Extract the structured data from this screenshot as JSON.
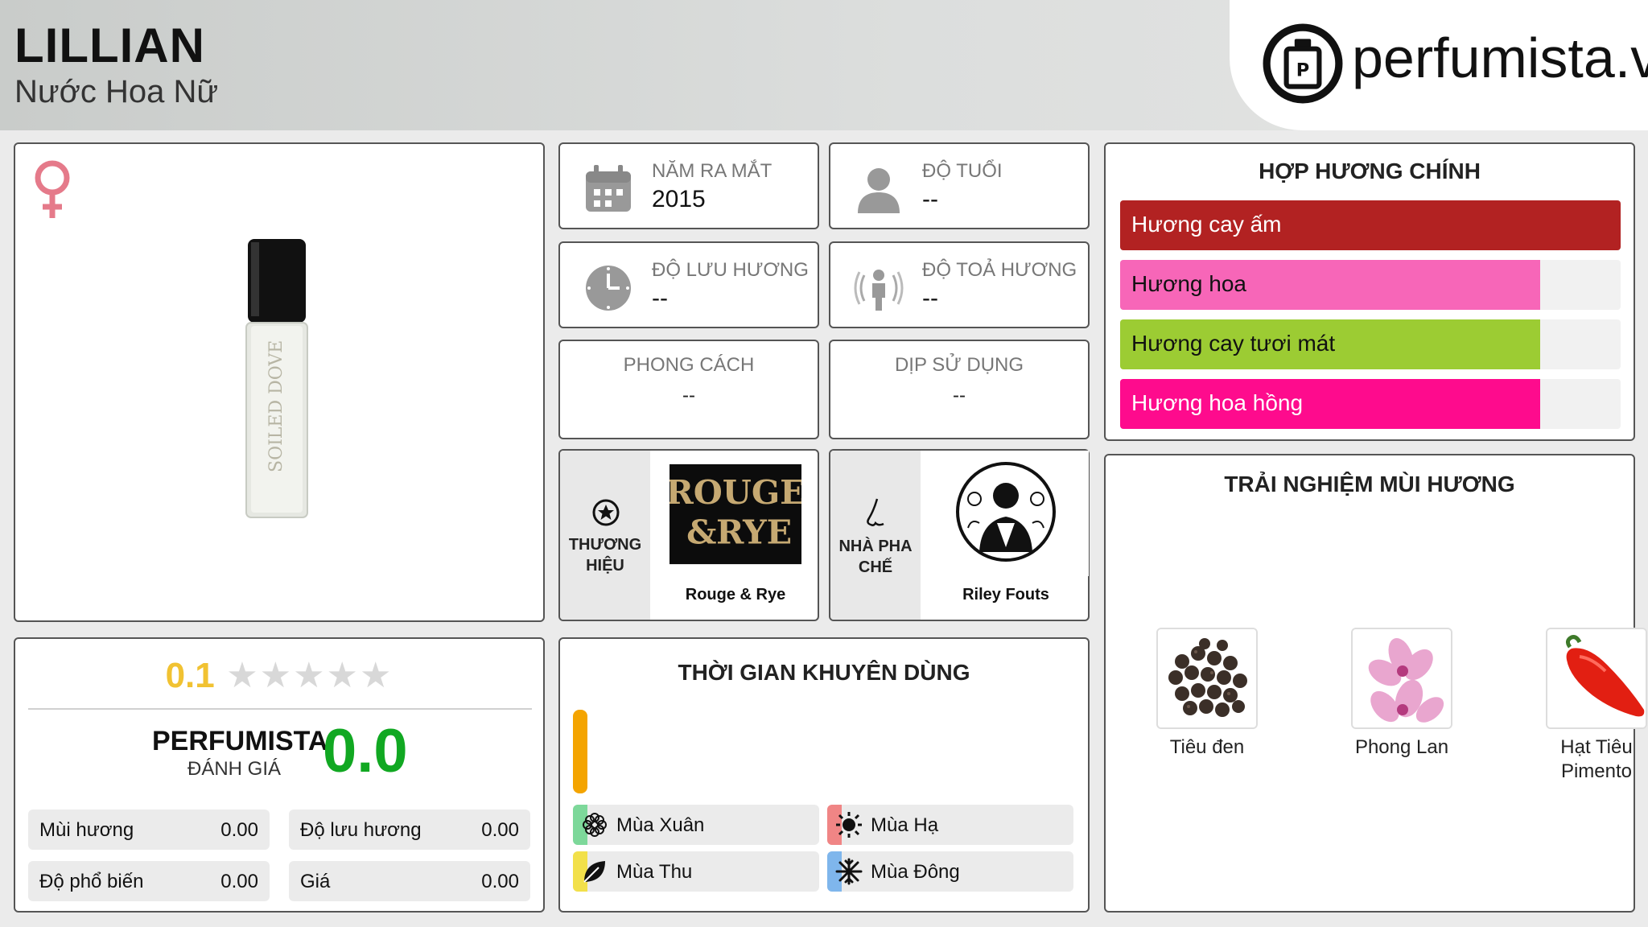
{
  "header": {
    "title": "LILLIAN",
    "subtitle": "Nước Hoa Nữ",
    "site": "perfumista.vn"
  },
  "product": {
    "gender_icon": "female-icon",
    "bottle_text": "SOILED DOVE"
  },
  "info": {
    "launch_year": {
      "label": "NĂM RA MẮT",
      "value": "2015",
      "icon": "calendar-icon"
    },
    "age": {
      "label": "ĐỘ TUỔI",
      "value": "--",
      "icon": "person-icon"
    },
    "longevity": {
      "label": "ĐỘ LƯU HƯƠNG",
      "value": "--",
      "icon": "clock-icon"
    },
    "sillage": {
      "label": "ĐỘ TOẢ HƯƠNG",
      "value": "--",
      "icon": "sillage-icon"
    },
    "style": {
      "label": "PHONG CÁCH",
      "value": "--"
    },
    "occasion": {
      "label": "DỊP SỬ DỤNG",
      "value": "--"
    }
  },
  "brand": {
    "label": "THƯƠNG HIỆU",
    "name": "Rouge & Rye",
    "logo_text_1": "ROUGE",
    "logo_text_2": "&",
    "logo_text_3": "RYE"
  },
  "perfumer": {
    "label": "NHÀ PHA CHẾ",
    "name": "Riley Fouts"
  },
  "accords": {
    "title": "HỢP HƯƠNG CHÍNH",
    "items": [
      {
        "label": "Hương cay ấm",
        "value": 1.0,
        "color": "#b22222",
        "text_color": "#ffffff"
      },
      {
        "label": "Hương hoa",
        "value": 0.84,
        "color": "#f766b8",
        "text_color": "#111111"
      },
      {
        "label": "Hương cay tươi mát",
        "value": 0.84,
        "color": "#9ccc33",
        "text_color": "#111111"
      },
      {
        "label": "Hương hoa hồng",
        "value": 0.84,
        "color": "#fe0b8d",
        "text_color": "#ffffff"
      }
    ]
  },
  "notes": {
    "title": "TRẢI NGHIỆM MÙI HƯƠNG",
    "items": [
      {
        "label": "Tiêu đen"
      },
      {
        "label": "Phong Lan"
      },
      {
        "label": "Hạt Tiêu Pimento"
      }
    ]
  },
  "rating": {
    "user_score": "0.1",
    "stars": "★★★★★",
    "perfumista_label": "PERFUMISTA",
    "perfumista_sub": "ĐÁNH GIÁ",
    "perfumista_score": "0.0",
    "stats": [
      {
        "label": "Mùi hương",
        "value": "0.00"
      },
      {
        "label": "Độ lưu hương",
        "value": "0.00"
      },
      {
        "label": "Độ phổ biến",
        "value": "0.00"
      },
      {
        "label": "Giá",
        "value": "0.00"
      }
    ]
  },
  "seasons": {
    "title": "THỜI GIAN KHUYÊN DÙNG",
    "items": [
      {
        "label": "Mùa Xuân",
        "color": "#7dd89a",
        "icon": "flower-icon"
      },
      {
        "label": "Mùa Hạ",
        "color": "#f08585",
        "icon": "sun-icon"
      },
      {
        "label": "Mùa Thu",
        "color": "#f2e04a",
        "icon": "leaf-icon"
      },
      {
        "label": "Mùa Đông",
        "color": "#7fb6ec",
        "icon": "snowflake-icon"
      }
    ]
  }
}
